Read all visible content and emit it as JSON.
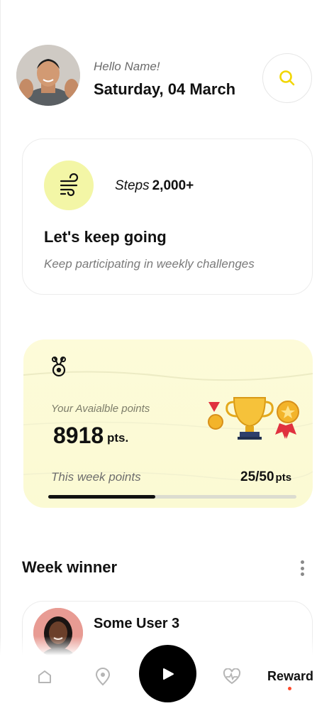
{
  "header": {
    "greeting": "Hello Name!",
    "date": "Saturday, 04 March"
  },
  "steps_card": {
    "steps_key": "Steps",
    "steps_value": "2,000+",
    "title": "Let's keep going",
    "subtitle": "Keep participating in weekly challenges"
  },
  "points_card": {
    "label": "Your Avaialble points",
    "value": "8918",
    "unit": "pts.",
    "week_label": "This week points",
    "week_value": "25/50",
    "week_unit": "pts",
    "week_progress": 0.43
  },
  "winner_section": {
    "title": "Week winner",
    "winner_name": "Some User 3"
  },
  "nav": {
    "items": [
      "home-icon",
      "location-icon",
      "play-icon",
      "heart-pulse-icon"
    ],
    "active_label": "Reward"
  },
  "colors": {
    "accent_yellow": "#f3f6a6",
    "search_icon": "#f2d600",
    "points_bg": "#fcfad6",
    "active_dot": "#ff4a2b"
  }
}
